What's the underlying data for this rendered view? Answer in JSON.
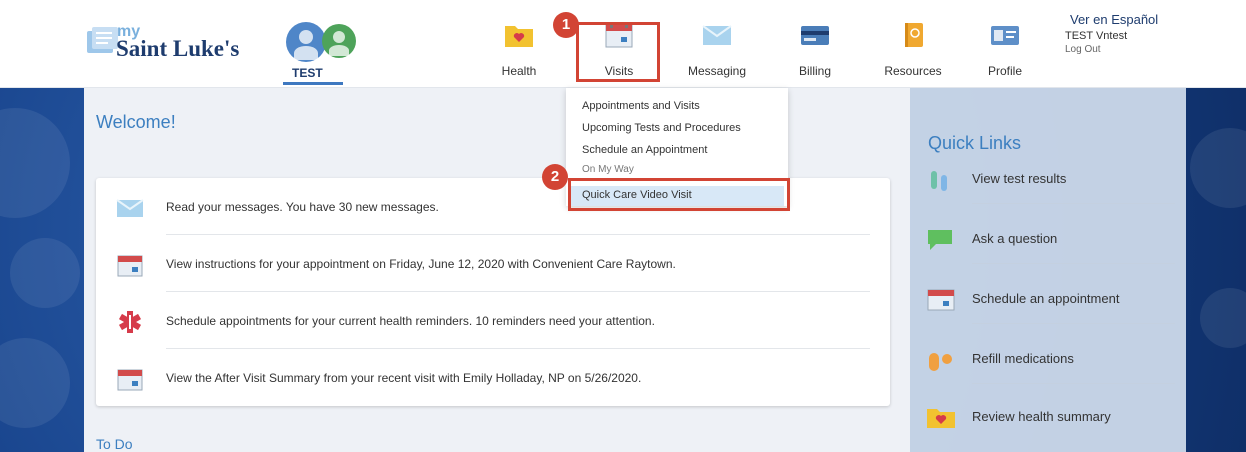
{
  "brand": {
    "my": "my",
    "name": "Saint Luke's"
  },
  "account": {
    "label": "TEST"
  },
  "nav": [
    {
      "label": "Health",
      "icon": "folder-heart-icon"
    },
    {
      "label": "Visits",
      "icon": "calendar-icon"
    },
    {
      "label": "Messaging",
      "icon": "envelope-icon"
    },
    {
      "label": "Billing",
      "icon": "credit-card-icon"
    },
    {
      "label": "Resources",
      "icon": "book-icon"
    },
    {
      "label": "Profile",
      "icon": "id-card-icon"
    }
  ],
  "header_right": {
    "lang": "Ver en Español",
    "user": "TEST Vntest",
    "logout": "Log Out"
  },
  "callouts": [
    "1",
    "2"
  ],
  "dropdown": {
    "items": [
      "Appointments and Visits",
      "Upcoming Tests and Procedures",
      "Schedule an Appointment",
      "On My Way",
      "Quick Care Video Visit"
    ],
    "selected": "Quick Care Video Visit"
  },
  "welcome": "Welcome!",
  "messages": [
    {
      "icon": "envelope-icon",
      "text": "Read your messages. You have 30 new messages."
    },
    {
      "icon": "calendar-icon",
      "text": "View instructions for your appointment on Friday, June 12, 2020 with Convenient Care Raytown."
    },
    {
      "icon": "medical-star-icon",
      "text": "Schedule appointments for your current health reminders. 10 reminders need your attention."
    },
    {
      "icon": "calendar-icon",
      "text": "View the After Visit Summary from your recent visit with Emily Holladay, NP on 5/26/2020."
    }
  ],
  "todo": "To Do",
  "quick_links": {
    "title": "Quick Links",
    "items": [
      {
        "label": "View test results",
        "icon": "test-tubes-icon"
      },
      {
        "label": "Ask a question",
        "icon": "speech-bubble-icon"
      },
      {
        "label": "Schedule an appointment",
        "icon": "calendar-icon"
      },
      {
        "label": "Refill medications",
        "icon": "pill-icon"
      },
      {
        "label": "Review health summary",
        "icon": "folder-heart-icon"
      }
    ]
  },
  "colors": {
    "brand_navy": "#1e3c6e",
    "accent_blue": "#3c7fc0",
    "callout_red": "#d24434"
  }
}
